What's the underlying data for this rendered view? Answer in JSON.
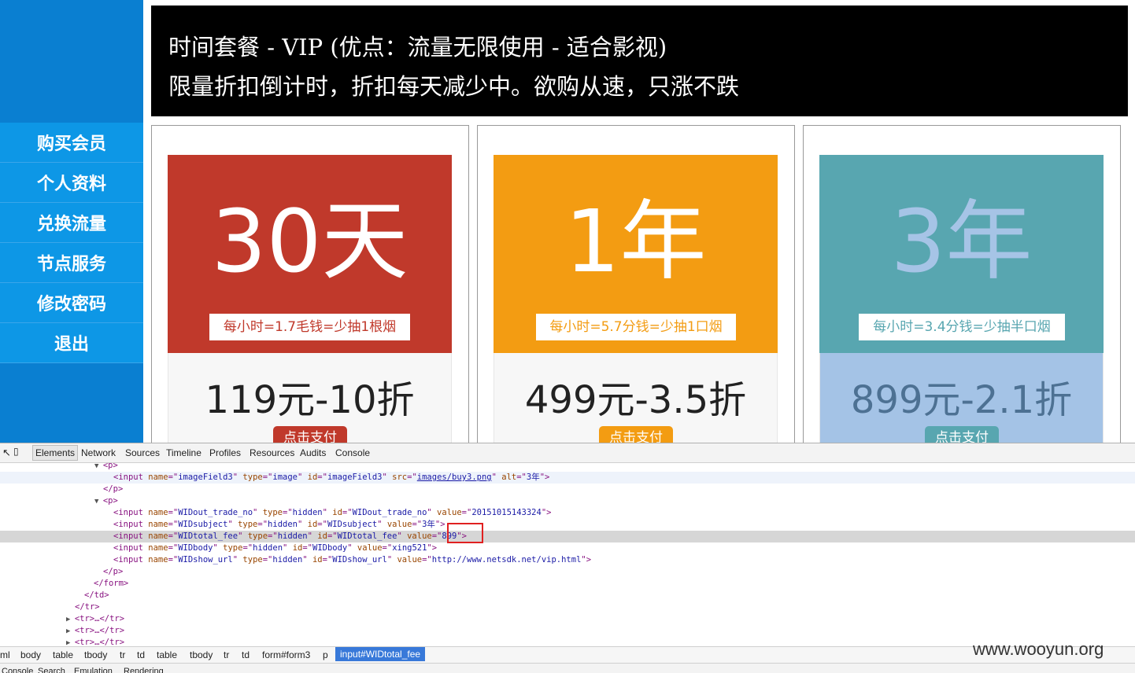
{
  "sidebar": {
    "items": [
      {
        "label": "购买会员"
      },
      {
        "label": "个人资料"
      },
      {
        "label": "兑换流量"
      },
      {
        "label": "节点服务"
      },
      {
        "label": "修改密码"
      },
      {
        "label": "退出"
      }
    ]
  },
  "banner": {
    "line1": "时间套餐 - VIP (优点：流量无限使用 - 适合影视)",
    "line2": "限量折扣倒计时，折扣每天减少中。欲购从速，只涨不跌"
  },
  "cards": [
    {
      "duration": "30天",
      "note": "每小时=1.7毛钱=少抽1根烟",
      "price": "119元-10折",
      "pay_label": "点击支付",
      "colors": {
        "top": "#c0392b",
        "bottom": "#f7f7f7",
        "big": "#ffffff",
        "note": "#c0392b",
        "price": "#222222",
        "pay": "#c0392b"
      }
    },
    {
      "duration": "1年",
      "note": "每小时=5.7分钱=少抽1口烟",
      "price": "499元-3.5折",
      "pay_label": "点击支付",
      "colors": {
        "top": "#f39c12",
        "bottom": "#f7f7f7",
        "big": "#ffffff",
        "note": "#f39c12",
        "price": "#222222",
        "pay": "#f39c12"
      }
    },
    {
      "duration": "3年",
      "note": "每小时=3.4分钱=少抽半口烟",
      "price": "899元-2.1折",
      "pay_label": "点击支付",
      "colors": {
        "top": "#58a6b0",
        "bottom": "#a4c3e6",
        "big": "#a6c4e6",
        "note": "#58a6b0",
        "price": "#4d7193",
        "pay": "#58a6b0"
      }
    }
  ],
  "devtools": {
    "tabs": [
      "Elements",
      "Network",
      "Sources",
      "Timeline",
      "Profiles",
      "Resources",
      "Audits",
      "Console"
    ],
    "active_tab": "Elements",
    "breadcrumbs": [
      "ml",
      "body",
      "table",
      "tbody",
      "tr",
      "td",
      "table",
      "tbody",
      "tr",
      "td",
      "form#form3",
      "p",
      "input#WIDtotal_fee"
    ],
    "bottom_tabs": [
      "Console",
      "Search",
      "Emulation",
      "Rendering"
    ],
    "code_lines": [
      {
        "tokens": [
          {
            "t": "tn",
            "v": "<p>"
          }
        ]
      },
      {
        "tokens": [
          {
            "t": "tn",
            "v": "<input "
          },
          {
            "t": "an",
            "v": "name"
          },
          {
            "t": "tn",
            "v": "=\""
          },
          {
            "t": "av",
            "v": "imageField3"
          },
          {
            "t": "tn",
            "v": "\" "
          },
          {
            "t": "an",
            "v": "type"
          },
          {
            "t": "tn",
            "v": "=\""
          },
          {
            "t": "av",
            "v": "image"
          },
          {
            "t": "tn",
            "v": "\" "
          },
          {
            "t": "an",
            "v": "id"
          },
          {
            "t": "tn",
            "v": "=\""
          },
          {
            "t": "av",
            "v": "imageField3"
          },
          {
            "t": "tn",
            "v": "\" "
          },
          {
            "t": "an",
            "v": "src"
          },
          {
            "t": "tn",
            "v": "=\""
          },
          {
            "t": "lnk",
            "v": "images/buy3.png"
          },
          {
            "t": "tn",
            "v": "\" "
          },
          {
            "t": "an",
            "v": "alt"
          },
          {
            "t": "tn",
            "v": "=\""
          },
          {
            "t": "av",
            "v": "3年"
          },
          {
            "t": "tn",
            "v": "\">"
          }
        ]
      },
      {
        "tokens": [
          {
            "t": "tn",
            "v": "</p>"
          }
        ]
      },
      {
        "tokens": [
          {
            "t": "tn",
            "v": "<p>"
          }
        ]
      },
      {
        "tokens": [
          {
            "t": "tn",
            "v": "<input "
          },
          {
            "t": "an",
            "v": "name"
          },
          {
            "t": "tn",
            "v": "=\""
          },
          {
            "t": "av",
            "v": "WIDout_trade_no"
          },
          {
            "t": "tn",
            "v": "\" "
          },
          {
            "t": "an",
            "v": "type"
          },
          {
            "t": "tn",
            "v": "=\""
          },
          {
            "t": "av",
            "v": "hidden"
          },
          {
            "t": "tn",
            "v": "\" "
          },
          {
            "t": "an",
            "v": "id"
          },
          {
            "t": "tn",
            "v": "=\""
          },
          {
            "t": "av",
            "v": "WIDout_trade_no"
          },
          {
            "t": "tn",
            "v": "\" "
          },
          {
            "t": "an",
            "v": "value"
          },
          {
            "t": "tn",
            "v": "=\""
          },
          {
            "t": "av",
            "v": "20151015143324"
          },
          {
            "t": "tn",
            "v": "\">"
          }
        ]
      },
      {
        "tokens": [
          {
            "t": "tn",
            "v": "<input "
          },
          {
            "t": "an",
            "v": "name"
          },
          {
            "t": "tn",
            "v": "=\""
          },
          {
            "t": "av",
            "v": "WIDsubject"
          },
          {
            "t": "tn",
            "v": "\" "
          },
          {
            "t": "an",
            "v": "type"
          },
          {
            "t": "tn",
            "v": "=\""
          },
          {
            "t": "av",
            "v": "hidden"
          },
          {
            "t": "tn",
            "v": "\" "
          },
          {
            "t": "an",
            "v": "id"
          },
          {
            "t": "tn",
            "v": "=\""
          },
          {
            "t": "av",
            "v": "WIDsubject"
          },
          {
            "t": "tn",
            "v": "\" "
          },
          {
            "t": "an",
            "v": "value"
          },
          {
            "t": "tn",
            "v": "=\""
          },
          {
            "t": "av",
            "v": "3年"
          },
          {
            "t": "tn",
            "v": "\">"
          }
        ]
      },
      {
        "tokens": [
          {
            "t": "tn",
            "v": "<input "
          },
          {
            "t": "an",
            "v": "name"
          },
          {
            "t": "tn",
            "v": "=\""
          },
          {
            "t": "av",
            "v": "WIDtotal_fee"
          },
          {
            "t": "tn",
            "v": "\" "
          },
          {
            "t": "an",
            "v": "type"
          },
          {
            "t": "tn",
            "v": "=\""
          },
          {
            "t": "av",
            "v": "hidden"
          },
          {
            "t": "tn",
            "v": "\" "
          },
          {
            "t": "an",
            "v": "id"
          },
          {
            "t": "tn",
            "v": "=\""
          },
          {
            "t": "av",
            "v": "WIDtotal_fee"
          },
          {
            "t": "tn",
            "v": "\" "
          },
          {
            "t": "an",
            "v": "value"
          },
          {
            "t": "tn",
            "v": "=\""
          },
          {
            "t": "av",
            "v": "899"
          },
          {
            "t": "tn",
            "v": "\">"
          }
        ]
      },
      {
        "tokens": [
          {
            "t": "tn",
            "v": "<input "
          },
          {
            "t": "an",
            "v": "name"
          },
          {
            "t": "tn",
            "v": "=\""
          },
          {
            "t": "av",
            "v": "WIDbody"
          },
          {
            "t": "tn",
            "v": "\" "
          },
          {
            "t": "an",
            "v": "type"
          },
          {
            "t": "tn",
            "v": "=\""
          },
          {
            "t": "av",
            "v": "hidden"
          },
          {
            "t": "tn",
            "v": "\" "
          },
          {
            "t": "an",
            "v": "id"
          },
          {
            "t": "tn",
            "v": "=\""
          },
          {
            "t": "av",
            "v": "WIDbody"
          },
          {
            "t": "tn",
            "v": "\" "
          },
          {
            "t": "an",
            "v": "value"
          },
          {
            "t": "tn",
            "v": "=\""
          },
          {
            "t": "av",
            "v": "xing521"
          },
          {
            "t": "tn",
            "v": "\">"
          }
        ]
      },
      {
        "tokens": [
          {
            "t": "tn",
            "v": "<input "
          },
          {
            "t": "an",
            "v": "name"
          },
          {
            "t": "tn",
            "v": "=\""
          },
          {
            "t": "av",
            "v": "WIDshow_url"
          },
          {
            "t": "tn",
            "v": "\" "
          },
          {
            "t": "an",
            "v": "type"
          },
          {
            "t": "tn",
            "v": "=\""
          },
          {
            "t": "av",
            "v": "hidden"
          },
          {
            "t": "tn",
            "v": "\" "
          },
          {
            "t": "an",
            "v": "id"
          },
          {
            "t": "tn",
            "v": "=\""
          },
          {
            "t": "av",
            "v": "WIDshow_url"
          },
          {
            "t": "tn",
            "v": "\" "
          },
          {
            "t": "an",
            "v": "value"
          },
          {
            "t": "tn",
            "v": "=\""
          },
          {
            "t": "av",
            "v": "http://www.netsdk.net/vip.html"
          },
          {
            "t": "tn",
            "v": "\">"
          }
        ]
      },
      {
        "tokens": [
          {
            "t": "tn",
            "v": "</p>"
          }
        ]
      },
      {
        "tokens": [
          {
            "t": "tn",
            "v": "</form>"
          }
        ]
      },
      {
        "tokens": [
          {
            "t": "tn",
            "v": "</td>"
          }
        ]
      },
      {
        "tokens": [
          {
            "t": "tn",
            "v": "</tr>"
          }
        ]
      },
      {
        "tokens": [
          {
            "t": "tn",
            "v": "<tr>…</tr>"
          }
        ]
      },
      {
        "tokens": [
          {
            "t": "tn",
            "v": "<tr>…</tr>"
          }
        ]
      },
      {
        "tokens": [
          {
            "t": "tn",
            "v": "<tr>…</tr>"
          }
        ]
      }
    ]
  },
  "watermark": "www.wooyun.org"
}
